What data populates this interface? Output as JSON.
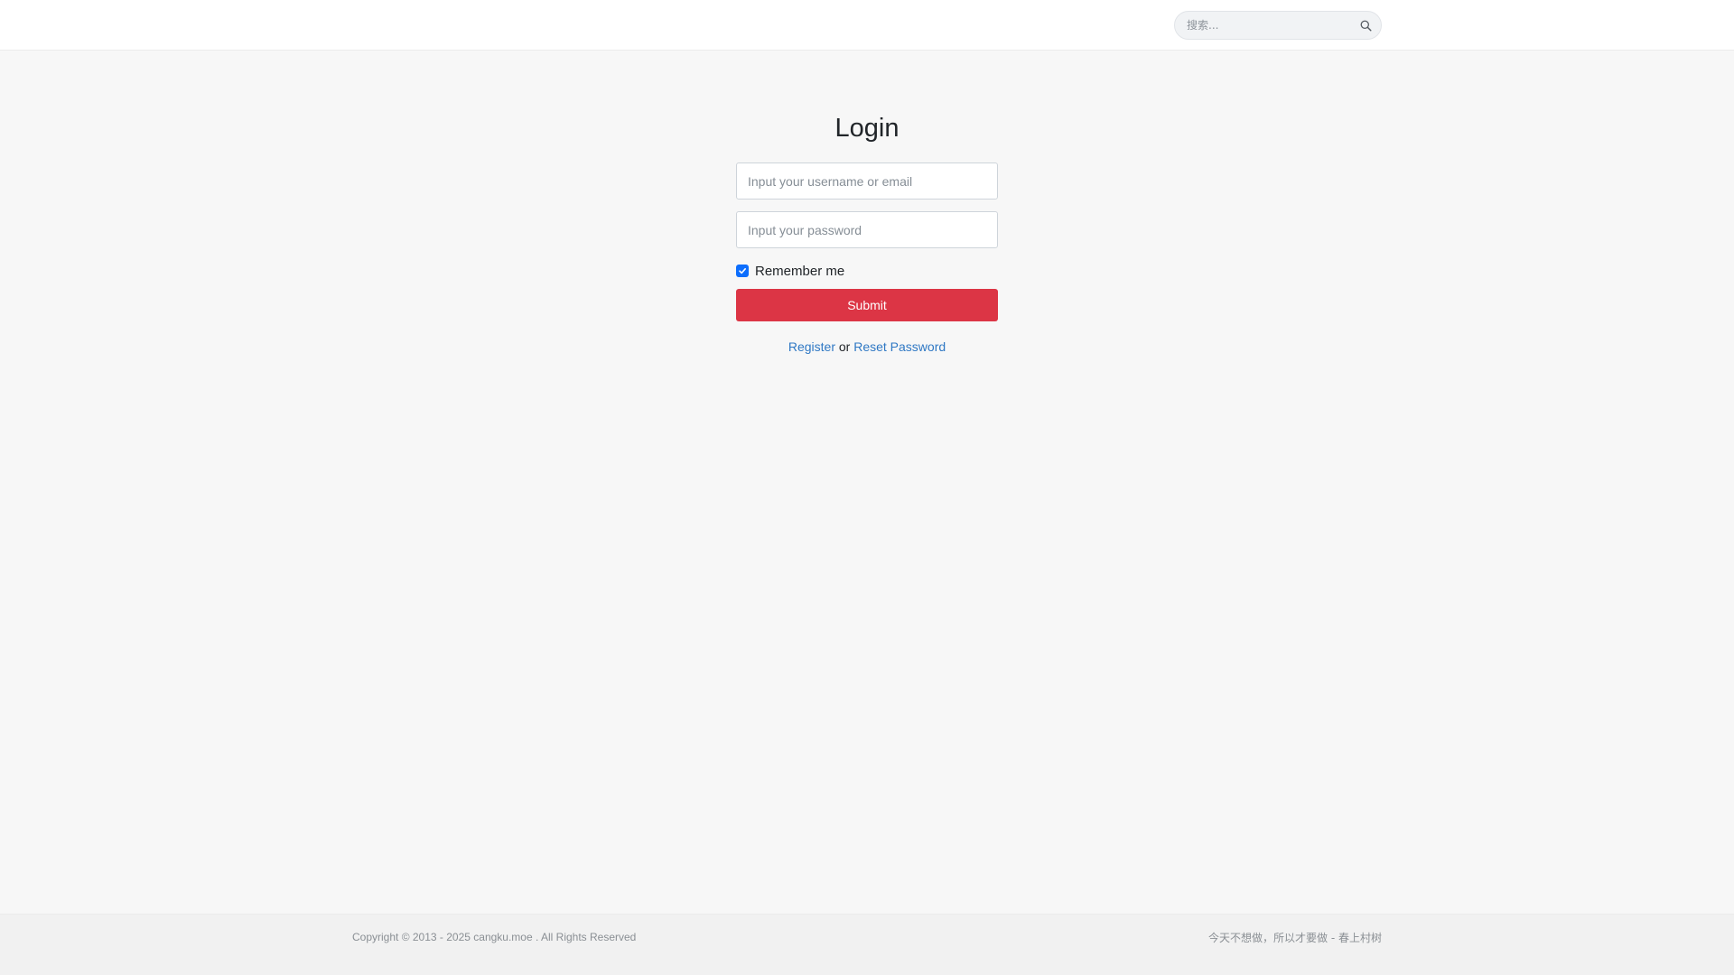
{
  "header": {
    "search": {
      "placeholder": "搜索..."
    },
    "icons": {
      "search": "search-icon"
    }
  },
  "login": {
    "title": "Login",
    "username_placeholder": "Input your username or email",
    "password_placeholder": "Input your password",
    "remember_label": "Remember me",
    "remember_checked": true,
    "submit_label": "Submit",
    "register_label": "Register",
    "or_text": " or ",
    "reset_label": "Reset Password"
  },
  "footer": {
    "copyright_prefix": "Copyright © 2013 - 2025 ",
    "site_name": "cangku.moe",
    "copyright_suffix": " . All Rights Reserved",
    "quote": "今天不想做，所以才要做 - 春上村树"
  },
  "colors": {
    "accent": "#dc3545",
    "link": "#2f78c4",
    "checkbox": "#0d6efd",
    "background": "#f7f7f7"
  }
}
